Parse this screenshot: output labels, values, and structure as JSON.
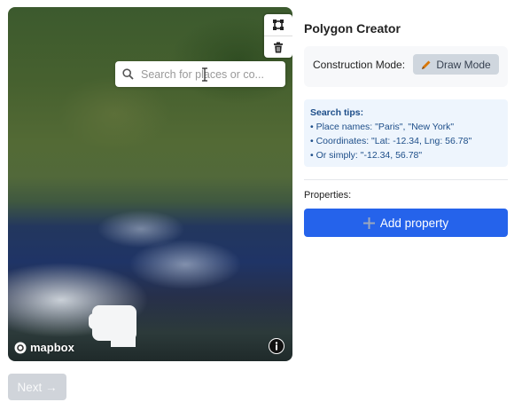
{
  "map": {
    "search": {
      "placeholder": "Search for places or co...",
      "value": ""
    },
    "controls": {
      "polygon_icon": "polygon-icon",
      "trash_icon": "trash-icon"
    },
    "logo_text": "mapbox",
    "info_icon": "info-icon"
  },
  "footer": {
    "next_label": "Next →"
  },
  "panel": {
    "title": "Polygon Creator",
    "construction_mode_label": "Construction Mode:",
    "draw_mode_label": "Draw Mode",
    "search_tips": {
      "title": "Search tips:",
      "items": [
        "• Place names: \"Paris\", \"New York\"",
        "• Coordinates: \"Lat: -12.34, Lng: 56.78\"",
        "• Or simply: \"-12.34, 56.78\""
      ]
    },
    "properties_label": "Properties:",
    "add_property_label": "Add property"
  },
  "colors": {
    "primary": "#2563eb",
    "tips_bg": "#eef5fd",
    "tips_text": "#1d4e89"
  }
}
